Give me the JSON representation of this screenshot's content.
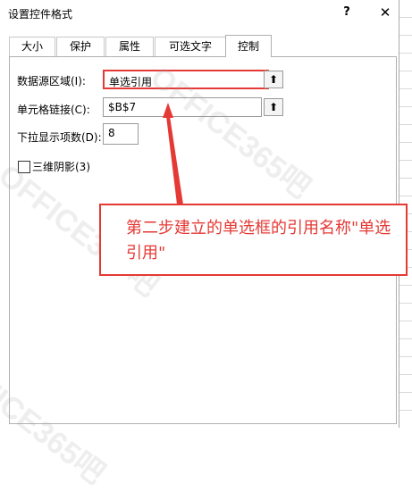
{
  "dialog": {
    "title": "设置控件格式",
    "help_glyph": "?",
    "close_glyph": "✕"
  },
  "tabs": [
    {
      "label": "大小",
      "active": false
    },
    {
      "label": "保护",
      "active": false
    },
    {
      "label": "属性",
      "active": false
    },
    {
      "label": "可选文字",
      "active": false
    },
    {
      "label": "控制",
      "active": true
    }
  ],
  "form": {
    "input_range_label": "数据源区域(I):",
    "input_range_value": "单选引用",
    "cell_link_label": "单元格链接(C):",
    "cell_link_value": "$B$7",
    "dropdown_lines_label": "下拉显示项数(D):",
    "dropdown_lines_value": "8",
    "shading_label": "三维阴影(3)",
    "shading_checked": false,
    "collapse_glyph": "⬆"
  },
  "annotation": {
    "text": "第二步建立的单选框的引用名称\"单选引用\""
  },
  "watermark": {
    "text": "OFFICE365吧"
  },
  "colors": {
    "accent_red": "#e53935"
  }
}
